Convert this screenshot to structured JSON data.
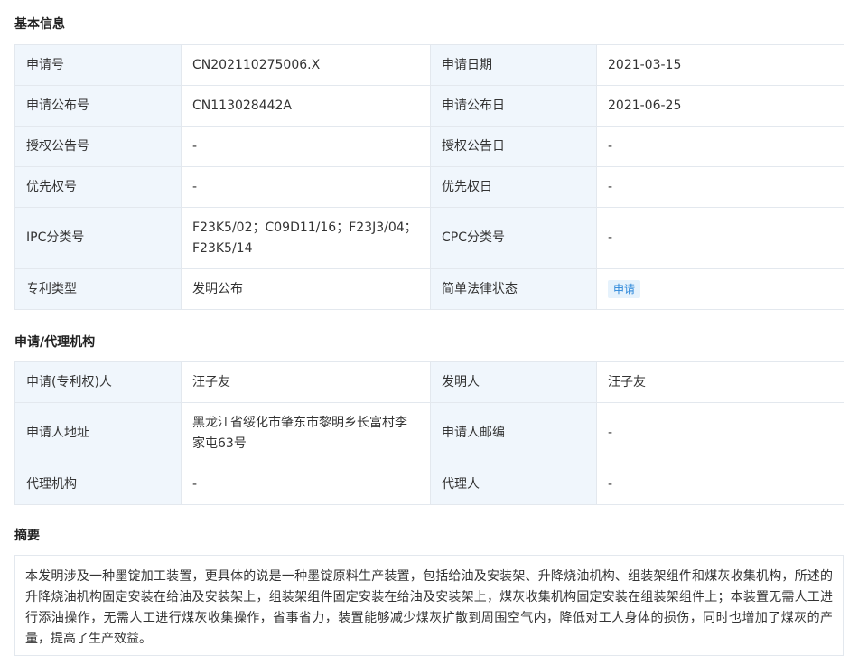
{
  "basic": {
    "title": "基本信息",
    "rows": [
      [
        {
          "k": "申请号",
          "v": "CN202110275006.X"
        },
        {
          "k": "申请日期",
          "v": "2021-03-15"
        }
      ],
      [
        {
          "k": "申请公布号",
          "v": "CN113028442A"
        },
        {
          "k": "申请公布日",
          "v": "2021-06-25"
        }
      ],
      [
        {
          "k": "授权公告号",
          "v": "-"
        },
        {
          "k": "授权公告日",
          "v": "-"
        }
      ],
      [
        {
          "k": "优先权号",
          "v": "-"
        },
        {
          "k": "优先权日",
          "v": "-"
        }
      ],
      [
        {
          "k": "IPC分类号",
          "v": "F23K5/02；C09D11/16；F23J3/04；F23K5/14"
        },
        {
          "k": "CPC分类号",
          "v": "-"
        }
      ],
      [
        {
          "k": "专利类型",
          "v": "发明公布"
        },
        {
          "k": "简单法律状态",
          "v": "申请"
        }
      ]
    ]
  },
  "agency": {
    "title": "申请/代理机构",
    "rows": [
      [
        {
          "k": "申请(专利权)人",
          "v": "汪子友"
        },
        {
          "k": "发明人",
          "v": "汪子友"
        }
      ],
      [
        {
          "k": "申请人地址",
          "v": "黑龙江省绥化市肇东市黎明乡长富村李家屯63号"
        },
        {
          "k": "申请人邮编",
          "v": "-"
        }
      ],
      [
        {
          "k": "代理机构",
          "v": "-"
        },
        {
          "k": "代理人",
          "v": "-"
        }
      ]
    ]
  },
  "abstract": {
    "title": "摘要",
    "text": "本发明涉及一种墨锭加工装置，更具体的说是一种墨锭原料生产装置，包括给油及安装架、升降烧油机构、组装架组件和煤灰收集机构，所述的升降烧油机构固定安装在给油及安装架上，组装架组件固定安装在给油及安装架上，煤灰收集机构固定安装在组装架组件上；本装置无需人工进行添油操作，无需人工进行煤灰收集操作，省事省力，装置能够减少煤灰扩散到周围空气内，降低对工人身体的损伤，同时也增加了煤灰的产量，提高了生产效益。"
  }
}
